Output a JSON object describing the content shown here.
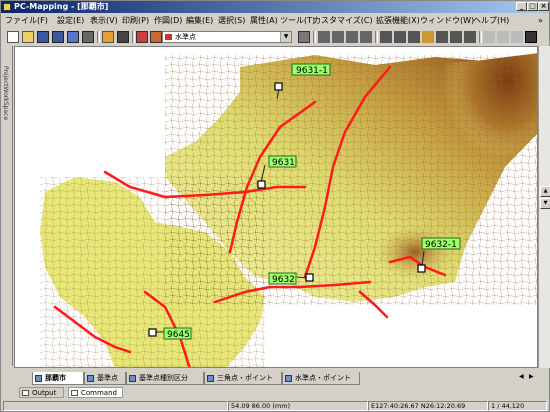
{
  "window": {
    "title": "PC-Mapping - [那覇市]",
    "controls": {
      "minimize": "_",
      "maximize": "□",
      "close": "×"
    }
  },
  "menu": [
    {
      "label": "ファイル(F)"
    },
    {
      "label": "設定(E)"
    },
    {
      "label": "表示(V)"
    },
    {
      "label": "印刷(P)"
    },
    {
      "label": "作図(D)"
    },
    {
      "label": "編集(E)"
    },
    {
      "label": "選択(S)"
    },
    {
      "label": "属性(A)"
    },
    {
      "label": "ツール(T)"
    },
    {
      "label": "カスタマイズ(C)"
    },
    {
      "label": "拡張機能(X)"
    },
    {
      "label": "ウィンドウ(W)"
    },
    {
      "label": "ヘルプ(H)"
    }
  ],
  "menu_overflow": "»",
  "toolbar": {
    "layer_combo_value": "水準点",
    "combo_arrow": "▼"
  },
  "sidebar": {
    "label": "ProjectWorkSpace"
  },
  "map": {
    "points": [
      {
        "label": "9631-1"
      },
      {
        "label": "9631"
      },
      {
        "label": "9632-1"
      },
      {
        "label": "9632"
      },
      {
        "label": "9645"
      }
    ]
  },
  "map_tabs": [
    {
      "label": "那覇市",
      "active": true
    },
    {
      "label": "基準点",
      "active": false
    },
    {
      "label": "基準点種別区分",
      "active": false
    },
    {
      "label": "三角点・ポイント",
      "active": false
    },
    {
      "label": "水準点・ポイント",
      "active": false
    }
  ],
  "map_tab_nav": {
    "prev": "◀",
    "next": "▶"
  },
  "output_tabs": [
    {
      "label": "Output"
    },
    {
      "label": "Command"
    }
  ],
  "status": {
    "scale_info": "54.09 86.00 (mm)",
    "coords": "E127:40:26.67 N26:12:20.69",
    "scale": "1 / 44,120"
  },
  "colors": {
    "title_start": "#0a246a",
    "label_fill": "#9aff6a",
    "road": "#ff1a1a",
    "terrain_low": "#f2f298",
    "terrain_high": "#8b4513"
  }
}
